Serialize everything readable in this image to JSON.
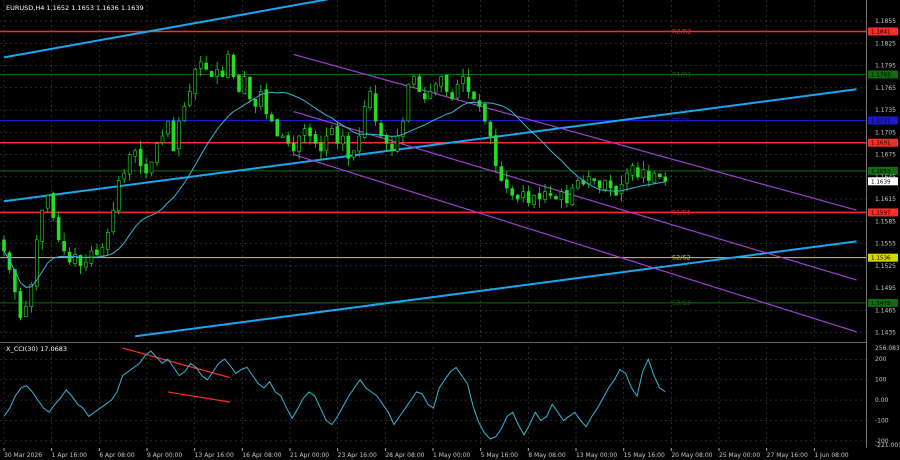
{
  "header": {
    "symbol_title": "EURUSD,H4  1.1652 1.1653 1.1636 1.1639",
    "indicator_title": "X_CCI(30) 17.0683"
  },
  "colors": {
    "background": "#000000",
    "candle": "#22dd22",
    "ma": "#35b6d8",
    "trend_blue": "#1aa7ef",
    "channel": "#a040d0",
    "red_level": "#ff2a2a",
    "yellow_level": "#d6d600",
    "green_level": "#0e6b0e",
    "cci": "#35b6d8",
    "divergence": "#ff2a2a",
    "grid": "#555555"
  },
  "chart_data": [
    {
      "type": "candlestick",
      "title": "EURUSD,H4  1.1652 1.1653 1.1636 1.1639",
      "x_tick_labels": [
        "30 Mar 2026",
        "1 Apr 16:00",
        "6 Apr 08:00",
        "9 Apr 00:00",
        "13 Apr 16:00",
        "16 Apr 08:00",
        "21 Apr 00:00",
        "23 Apr 16:00",
        "28 Apr 08:00",
        "1 May 00:00",
        "5 May 16:00",
        "8 May 08:00",
        "13 May 00:00",
        "15 May 16:00",
        "20 May 08:00",
        "25 May 00:00",
        "27 May 16:00",
        "1 Jun 08:00"
      ],
      "y_tick_labels": [
        "1.1855",
        "1.1825",
        "1.1795",
        "1.1765",
        "1.1735",
        "1.1705",
        "1.1675",
        "1.1645",
        "1.1615",
        "1.1585",
        "1.1555",
        "1.1525",
        "1.1495",
        "1.1465",
        "1.1435"
      ],
      "ylim": [
        1.1425,
        1.1878
      ],
      "levels": [
        {
          "label": "1.1841",
          "value": 1.1841,
          "color": "#ff2a2a",
          "text": "R2/R2"
        },
        {
          "label": "1.1783",
          "value": 1.1783,
          "color": "#0e6b0e",
          "text": "R1/R1"
        },
        {
          "label": "1.1721",
          "value": 1.1721,
          "color": "#1a1acc",
          "text": "PP/PP"
        },
        {
          "label": "1.1691",
          "value": 1.1691,
          "color": "#ff2a2a",
          "text": ""
        },
        {
          "label": "1.1653",
          "value": 1.1653,
          "color": "#0e6b0e",
          "text": ""
        },
        {
          "label": "1.1597",
          "value": 1.1597,
          "color": "#ff2a2a",
          "text": "S1/S1"
        },
        {
          "label": "1.1536",
          "value": 1.1536,
          "color": "#d6d600",
          "text": "S2/S2"
        },
        {
          "label": "1.1475",
          "value": 1.1475,
          "color": "#0e6b0e",
          "text": "S3/S3"
        }
      ],
      "current_price": "1.1639",
      "close": [
        1.1545,
        1.152,
        1.149,
        1.1455,
        1.147,
        1.15,
        1.156,
        1.16,
        1.162,
        1.159,
        1.156,
        1.1545,
        1.153,
        1.154,
        1.1525,
        1.153,
        1.1545,
        1.154,
        1.155,
        1.157,
        1.16,
        1.164,
        1.165,
        1.1675,
        1.168,
        1.166,
        1.165,
        1.1665,
        1.169,
        1.17,
        1.172,
        1.168,
        1.172,
        1.174,
        1.176,
        1.179,
        1.18,
        1.179,
        1.178,
        1.179,
        1.178,
        1.181,
        1.178,
        1.176,
        1.178,
        1.175,
        1.174,
        1.176,
        1.173,
        1.172,
        1.17,
        1.17,
        1.169,
        1.168,
        1.17,
        1.171,
        1.17,
        1.169,
        1.168,
        1.17,
        1.171,
        1.169,
        1.17,
        1.167,
        1.168,
        1.17,
        1.174,
        1.176,
        1.172,
        1.17,
        1.169,
        1.168,
        1.17,
        1.172,
        1.177,
        1.178,
        1.176,
        1.175,
        1.176,
        1.177,
        1.178,
        1.176,
        1.175,
        1.177,
        1.178,
        1.176,
        1.175,
        1.174,
        1.172,
        1.17,
        1.166,
        1.164,
        1.163,
        1.162,
        1.1615,
        1.1625,
        1.161,
        1.162,
        1.1615,
        1.1625,
        1.162,
        1.1615,
        1.1625,
        1.161,
        1.163,
        1.164,
        1.1635,
        1.1645,
        1.164,
        1.163,
        1.164,
        1.163,
        1.162,
        1.1635,
        1.165,
        1.166,
        1.1645,
        1.1655,
        1.164,
        1.165,
        1.1645,
        1.1639
      ],
      "ma_period": 20,
      "trend_lines": [
        {
          "from_bar": 0,
          "from_price": 1.1806,
          "to_bar": 62,
          "to_price": 1.1888
        },
        {
          "from_bar": 0,
          "from_price": 1.1612,
          "to_bar": 156,
          "to_price": 1.1763
        },
        {
          "from_bar": 24,
          "from_price": 1.143,
          "to_bar": 156,
          "to_price": 1.1558
        }
      ],
      "channel_lines": [
        {
          "from_bar": 53,
          "from_price": 1.181,
          "to_bar": 156,
          "to_price": 1.16
        },
        {
          "from_bar": 53,
          "from_price": 1.1733,
          "to_bar": 156,
          "to_price": 1.1506
        },
        {
          "from_bar": 53,
          "from_price": 1.1675,
          "to_bar": 156,
          "to_price": 1.1436
        }
      ]
    },
    {
      "type": "line",
      "title": "X_CCI(30) 17.0683",
      "series": [
        {
          "values": [
            -80,
            -40,
            20,
            60,
            70,
            40,
            0,
            -40,
            -60,
            -20,
            10,
            50,
            20,
            -20,
            -40,
            -80,
            -60,
            -40,
            -20,
            0,
            40,
            120,
            140,
            160,
            180,
            220,
            240,
            210,
            180,
            200,
            160,
            120,
            140,
            180,
            160,
            120,
            100,
            140,
            180,
            200,
            170,
            130,
            150,
            160,
            120,
            80,
            60,
            90,
            40,
            20,
            -40,
            -90,
            -40,
            10,
            40,
            20,
            -40,
            -100,
            -120,
            -80,
            -30,
            20,
            60,
            100,
            60,
            40,
            20,
            -20,
            -60,
            -120,
            -80,
            -40,
            0,
            40,
            30,
            -20,
            -40,
            60,
            100,
            140,
            160,
            120,
            80,
            -30,
            -110,
            -160,
            -190,
            -180,
            -140,
            -80,
            -60,
            -120,
            -170,
            -120,
            -60,
            -100,
            -80,
            -20,
            -60,
            -100,
            -80,
            -60,
            -100,
            -130,
            -80,
            -40,
            10,
            60,
            100,
            150,
            130,
            60,
            20,
            140,
            200,
            120,
            60,
            40
          ]
        }
      ],
      "y_tick_labels": [
        "256.0839",
        "200",
        "100",
        "0.00",
        "-100",
        "-200",
        "-221.001"
      ],
      "ylim": [
        -225,
        260
      ],
      "divergence_lines": [
        {
          "from_index": 21,
          "from_value": 255,
          "to_index": 40,
          "to_value": 110
        },
        {
          "from_index": 29,
          "from_value": 40,
          "to_index": 40,
          "to_value": -10
        }
      ]
    }
  ]
}
